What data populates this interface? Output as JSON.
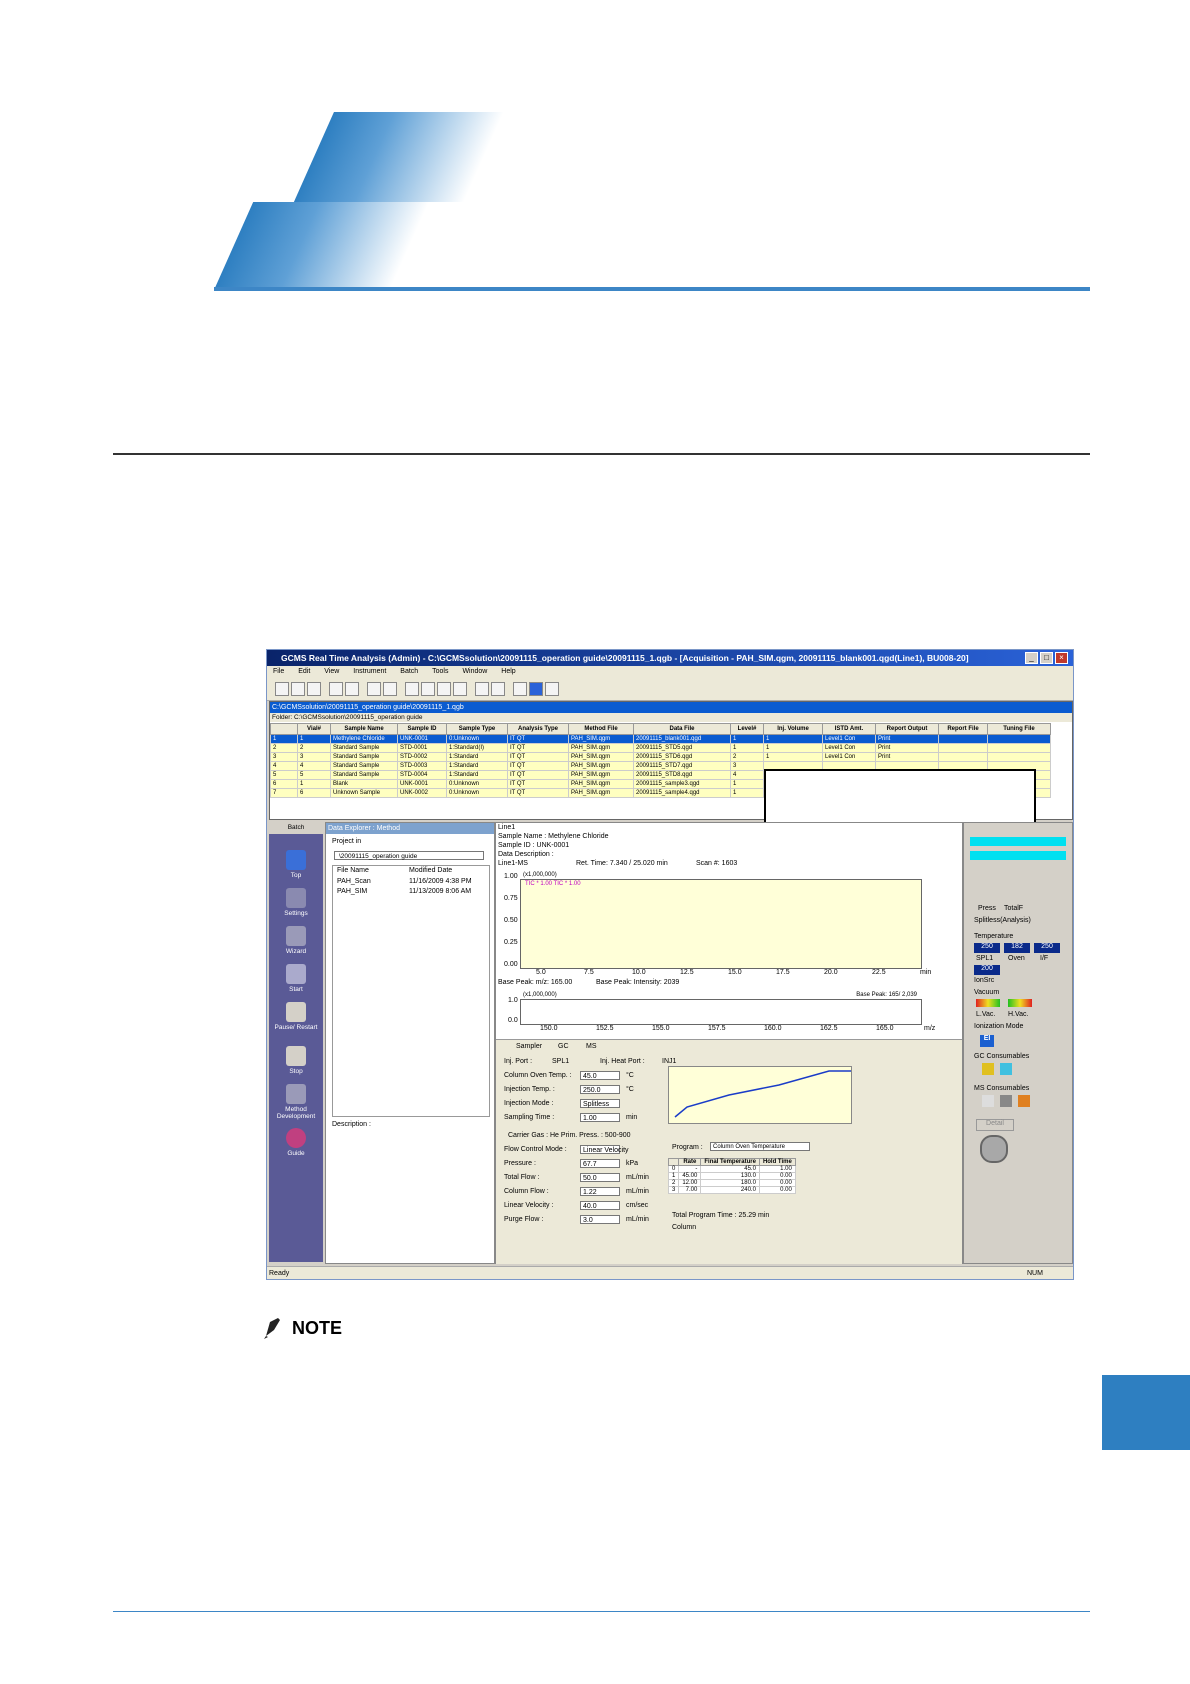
{
  "page": {
    "note_label": "NOTE"
  },
  "window": {
    "title": "GCMS Real Time Analysis (Admin) - C:\\GCMSsolution\\20091115_operation guide\\20091115_1.qgb - [Acquisition - PAH_SIM.qgm, 20091115_blank001.qgd(Line1), BU008-20]",
    "menu": [
      "File",
      "Edit",
      "View",
      "Instrument",
      "Batch",
      "Tools",
      "Window",
      "Help"
    ],
    "status_left": "Ready",
    "status_right": "NUM"
  },
  "batch": {
    "title": "C:\\GCMSsolution\\20091115_operation guide\\20091115_1.qgb",
    "folder": "Folder: C:\\GCMSsolution\\20091115_operation guide",
    "columns": [
      "",
      "Vial#",
      "Sample Name",
      "Sample ID",
      "Sample Type",
      "Analysis Type",
      "Method File",
      "Data File",
      "Level#",
      "Inj. Volume",
      "ISTD Amt.",
      "Report Output",
      "Report File",
      "Tuning File"
    ],
    "rows": [
      [
        "1",
        "1",
        "Methylene Chloride",
        "UNK-0001",
        "0:Unknown",
        "IT QT",
        "PAH_SIM.qgm",
        "20091115_blank001.qgd",
        "1",
        "1",
        "Level1 Con",
        "Print",
        "",
        ""
      ],
      [
        "2",
        "2",
        "Standard Sample",
        "STD-0001",
        "1:Standard(I)",
        "IT QT",
        "PAH_SIM.qgm",
        "20091115_STD5.qgd",
        "1",
        "1",
        "Level1 Con",
        "Print",
        "",
        ""
      ],
      [
        "3",
        "3",
        "Standard Sample",
        "STD-0002",
        "1:Standard",
        "IT QT",
        "PAH_SIM.qgm",
        "20091115_STD6.qgd",
        "2",
        "1",
        "Level1 Con",
        "Print",
        "",
        ""
      ],
      [
        "4",
        "4",
        "Standard Sample",
        "STD-0003",
        "1:Standard",
        "IT QT",
        "PAH_SIM.qgm",
        "20091115_STD7.qgd",
        "3",
        "",
        "",
        "",
        "",
        ""
      ],
      [
        "5",
        "5",
        "Standard Sample",
        "STD-0004",
        "1:Standard",
        "IT QT",
        "PAH_SIM.qgm",
        "20091115_STD8.qgd",
        "4",
        "",
        "",
        "",
        "",
        ""
      ],
      [
        "6",
        "1",
        "Blank",
        "UNK-0001",
        "0:Unknown",
        "IT QT",
        "PAH_SIM.qgm",
        "20091115_sample3.qgd",
        "1",
        "",
        "",
        "",
        "",
        ""
      ],
      [
        "7",
        "6",
        "Unknown Sample",
        "UNK-0002",
        "0:Unknown",
        "IT QT",
        "PAH_SIM.qgm",
        "20091115_sample4.qgd",
        "1",
        "",
        "",
        "",
        "",
        ""
      ]
    ]
  },
  "assistant": {
    "head": "Batch",
    "items": [
      "Top",
      "Settings",
      "Wizard",
      "Start",
      "Pause/ Restart",
      "Stop",
      "Method Development",
      "Guide"
    ]
  },
  "explorer": {
    "title": "Data Explorer : Method",
    "project_label": "Project in",
    "project_value": "\\20091115_operation guide",
    "col_name": "File Name",
    "col_date": "Modified Date",
    "files": [
      {
        "name": "PAH_Scan",
        "date": "11/16/2009 4:38 PM"
      },
      {
        "name": "PAH_SIM",
        "date": "11/13/2009 8:06 AM"
      }
    ],
    "description_label": "Description :"
  },
  "chrom": {
    "line": "Line1",
    "sample_name": "Sample Name : Methylene Chloride",
    "sample_id": "Sample ID : UNK-0001",
    "data_desc": "Data Description :",
    "mode": "Line1-MS",
    "ret_time": "Ret. Time: 7.340 / 25.020 min",
    "scan": "Scan #: 1603",
    "inten_label": "(x1,000,000)",
    "tic_labels": "TIC * 1.00   TIC * 1.00",
    "y_ticks": [
      "1.00",
      "0.75",
      "0.50",
      "0.25",
      "0.00"
    ],
    "x_ticks": [
      "5.0",
      "7.5",
      "10.0",
      "12.5",
      "15.0",
      "17.5",
      "20.0",
      "22.5"
    ],
    "x_unit": "min",
    "base_peak": "Base Peak: m/z: 165.00",
    "base_intensity": "Base Peak: Intensity: 2039",
    "ms_inten": "(x1,000,000)",
    "ms_base": "Base Peak: 165/ 2,039",
    "ms_y_ticks": [
      "1.0",
      "0.0"
    ],
    "ms_x_ticks": [
      "150.0",
      "152.5",
      "155.0",
      "157.5",
      "160.0",
      "162.5",
      "165.0"
    ],
    "ms_x_unit": "m/z"
  },
  "gc": {
    "tabs": [
      "Sampler",
      "GC",
      "MS"
    ],
    "inj_port_label": "Inj. Port :",
    "inj_port_value": "SPL1",
    "heat_port_label": "Inj. Heat Port :",
    "heat_port_value": "INJ1",
    "fields": [
      {
        "label": "Column Oven Temp. :",
        "value": "45.0",
        "unit": "°C"
      },
      {
        "label": "Injection Temp. :",
        "value": "250.0",
        "unit": "°C"
      },
      {
        "label": "Injection Mode :",
        "value": "Splitless",
        "unit": ""
      },
      {
        "label": "Sampling Time :",
        "value": "1.00",
        "unit": "min"
      }
    ],
    "carrier": "Carrier Gas : He   Prim. Press. : 500-900",
    "fields2": [
      {
        "label": "Flow Control Mode :",
        "value": "Linear Velocity",
        "unit": ""
      },
      {
        "label": "Pressure :",
        "value": "67.7",
        "unit": "kPa"
      },
      {
        "label": "Total Flow :",
        "value": "50.0",
        "unit": "mL/min"
      },
      {
        "label": "Column Flow :",
        "value": "1.22",
        "unit": "mL/min"
      },
      {
        "label": "Linear Velocity :",
        "value": "40.0",
        "unit": "cm/sec"
      },
      {
        "label": "Purge Flow :",
        "value": "3.0",
        "unit": "mL/min"
      }
    ],
    "program_label": "Program :",
    "program_value": "Column Oven Temperature",
    "rate_cols": [
      "Rate",
      "Final Temperature",
      "Hold Time"
    ],
    "rate_rows": [
      [
        "0",
        "-",
        "45.0",
        "1.00"
      ],
      [
        "1",
        "45.00",
        "130.0",
        "0.00"
      ],
      [
        "2",
        "12.00",
        "180.0",
        "0.00"
      ],
      [
        "3",
        "7.00",
        "240.0",
        "0.00"
      ]
    ],
    "total_time": "Total Program Time :     25.29  min",
    "column_label": "Column"
  },
  "monitor": {
    "press_label": "Press",
    "totalf_label": "TotalF",
    "split_label": "Splitless(Analysis)",
    "temp_label": "Temperature",
    "temps": [
      "250",
      "182",
      "250"
    ],
    "temp_names": [
      "SPL1",
      "Oven",
      "I/F"
    ],
    "ionsrc_value": "200",
    "ionsrc_label": "IonSrc",
    "vacuum_label": "Vacuum",
    "lvac": "L.Vac.",
    "hvac": "H.Vac.",
    "ion_mode_label": "Ionization Mode",
    "ion_mode": "EI",
    "gc_cons": "GC Consumables",
    "ms_cons": "MS Consumables",
    "detail": "Detail"
  }
}
